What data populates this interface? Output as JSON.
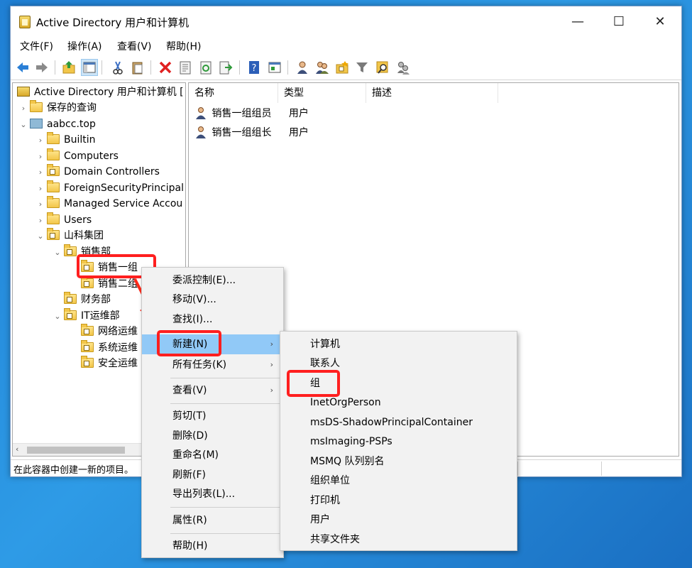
{
  "window": {
    "title": "Active Directory 用户和计算机",
    "controls": {
      "minimize": "—",
      "maximize": "☐",
      "close": "✕"
    }
  },
  "menubar": [
    "文件(F)",
    "操作(A)",
    "查看(V)",
    "帮助(H)"
  ],
  "tree": {
    "root": "Active Directory 用户和计算机 [",
    "saved_queries": "保存的查询",
    "domain": "aabcc.top",
    "builtin": "Builtin",
    "computers": "Computers",
    "domain_controllers": "Domain Controllers",
    "foreign": "ForeignSecurityPrincipal",
    "managed": "Managed Service Accou",
    "users": "Users",
    "group_company": "山科集团",
    "sales_dept": "销售部",
    "sales_group1": "销售一组",
    "sales_group2": "销售二组",
    "finance": "财务部",
    "it_ops": "IT运维部",
    "network_ops": "网络运维",
    "system_ops": "系统运维",
    "security_ops": "安全运维"
  },
  "list": {
    "columns": [
      "名称",
      "类型",
      "描述"
    ],
    "rows": [
      {
        "name": "销售一组组员",
        "type": "用户"
      },
      {
        "name": "销售一组组长",
        "type": "用户"
      }
    ]
  },
  "status": "在此容器中创建一新的项目。",
  "context_menu": {
    "delegate": "委派控制(E)...",
    "move": "移动(V)...",
    "find": "查找(I)...",
    "new": "新建(N)",
    "all_tasks": "所有任务(K)",
    "view": "查看(V)",
    "cut": "剪切(T)",
    "delete": "删除(D)",
    "rename": "重命名(M)",
    "refresh": "刷新(F)",
    "export": "导出列表(L)...",
    "properties": "属性(R)",
    "help": "帮助(H)",
    "submenu_arrow": "›"
  },
  "submenu": [
    "计算机",
    "联系人",
    "组",
    "InetOrgPerson",
    "msDS-ShadowPrincipalContainer",
    "msImaging-PSPs",
    "MSMQ 队列别名",
    "组织单位",
    "打印机",
    "用户",
    "共享文件夹"
  ],
  "colors": {
    "highlight": "#ff1f1f",
    "menu_hover": "#91c9f7",
    "arrow": "#ff2a1a"
  }
}
